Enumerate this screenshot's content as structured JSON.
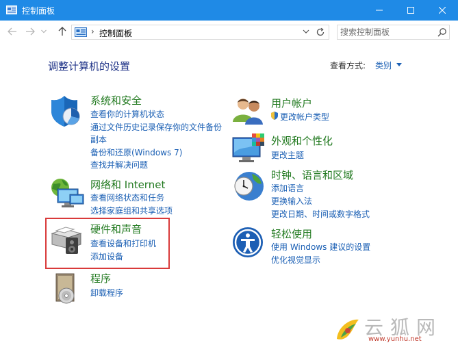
{
  "window": {
    "title": "控制面板",
    "accent": "#1f8ae6"
  },
  "address": {
    "breadcrumb": "控制面板",
    "separator": "›"
  },
  "search": {
    "placeholder": "搜索控制面板"
  },
  "main": {
    "heading": "调整计算机的设置",
    "view_by_label": "查看方式:",
    "view_by_value": "类别"
  },
  "categories": {
    "system": {
      "title": "系统和安全",
      "links": [
        "查看你的计算机状态",
        "通过文件历史记录保存你的文件备份",
        "副本",
        "备份和还原(Windows 7)",
        "查找并解决问题"
      ]
    },
    "network": {
      "title": "网络和 Internet",
      "links": [
        "查看网络状态和任务",
        "选择家庭组和共享选项"
      ]
    },
    "hardware": {
      "title": "硬件和声音",
      "links": [
        "查看设备和打印机",
        "添加设备"
      ]
    },
    "programs": {
      "title": "程序",
      "links": [
        "卸载程序"
      ]
    },
    "accounts": {
      "title": "用户帐户",
      "links": [
        "更改帐户类型"
      ]
    },
    "appearance": {
      "title": "外观和个性化",
      "links": [
        "更改主题"
      ]
    },
    "clock": {
      "title": "时钟、语言和区域",
      "links": [
        "添加语言",
        "更换输入法",
        "更改日期、时间或数字格式"
      ]
    },
    "ease": {
      "title": "轻松使用",
      "links": [
        "使用 Windows 建议的设置",
        "优化视觉显示"
      ]
    }
  },
  "watermark": {
    "text": "云狐网",
    "url": "www.yunhu.net"
  },
  "colors": {
    "category_title": "#227a20",
    "link": "#1a5fb4",
    "heading": "#1e3287",
    "highlight": "#d93a3a"
  }
}
